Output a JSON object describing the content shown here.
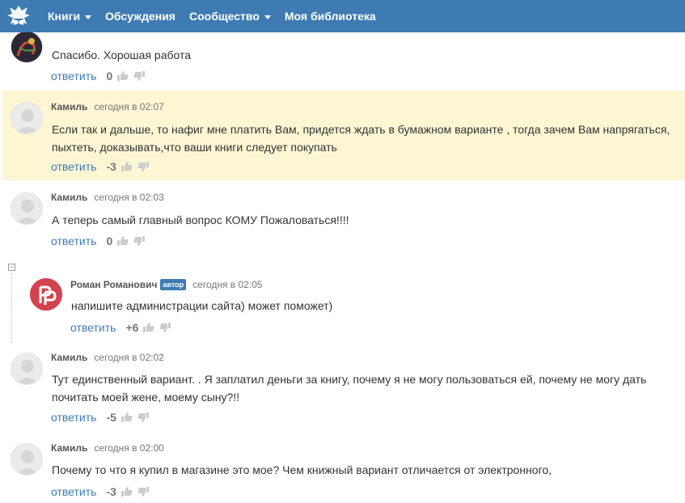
{
  "nav": {
    "items": [
      {
        "label": "Книги",
        "dropdown": true
      },
      {
        "label": "Обсуждения",
        "dropdown": false
      },
      {
        "label": "Сообщество",
        "dropdown": true
      },
      {
        "label": "Моя библиотека",
        "dropdown": false
      }
    ]
  },
  "colors": {
    "navbar": "#3e7bb3",
    "highlight": "#fdf6d3",
    "link": "#3e7bb3",
    "author_avatar": "#d3434f"
  },
  "comments": [
    {
      "author": "",
      "time": "",
      "text": "Спасибо. Хорошая работа",
      "reply": "ответить",
      "score": "0"
    },
    {
      "author": "Камиль",
      "time": "сегодня в 02:07",
      "text": "Если так и дальше, то нафиг мне платить Вам,  придется ждать в бумажном варианте , тогда зачем Вам напрягаться, пыхтеть, доказывать,что ваши книги следует покупать",
      "reply": "ответить",
      "score": "-3",
      "highlighted": true
    },
    {
      "author": "Камиль",
      "time": "сегодня в 02:03",
      "text": "А теперь самый главный вопрос  КОМУ Пожаловаться!!!!",
      "reply": "ответить",
      "score": "0"
    },
    {
      "author": "Роман Романович",
      "badge": "автор",
      "time": "сегодня в 02:05",
      "text": "напишите администрации сайта) может поможет)",
      "reply": "ответить",
      "score": "+6"
    },
    {
      "author": "Камиль",
      "time": "сегодня в 02:02",
      "text": "Тут единственный вариант.   . Я заплатил деньги за книгу, почему я не могу пользоваться ей, почему не могу дать почитать моей жене, моему сыну?!!",
      "reply": "ответить",
      "score": "-5"
    },
    {
      "author": "Камиль",
      "time": "сегодня в 02:00",
      "text": "Почему то что я купил в магазине это мое? Чем книжный вариант отличается от электронного,",
      "reply": "ответить",
      "score": "-3"
    }
  ],
  "collapse_symbol": "−"
}
